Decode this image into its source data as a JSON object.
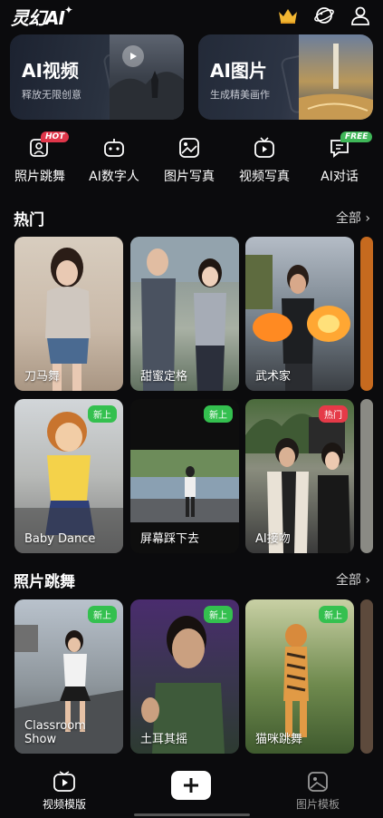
{
  "app": {
    "logo": "灵幻AI",
    "spark": "✦"
  },
  "heroes": [
    {
      "title": "AI视频",
      "subtitle": "释放无限创意"
    },
    {
      "title": "AI图片",
      "subtitle": "生成精美画作"
    }
  ],
  "quick_actions": [
    {
      "label": "照片跳舞",
      "badge": "HOT"
    },
    {
      "label": "AI数字人",
      "badge": ""
    },
    {
      "label": "图片写真",
      "badge": ""
    },
    {
      "label": "视频写真",
      "badge": ""
    },
    {
      "label": "AI对话",
      "badge": "FREE"
    }
  ],
  "sections": {
    "hot": {
      "title": "热门",
      "more": "全部",
      "row1": [
        {
          "label": "刀马舞",
          "tag": ""
        },
        {
          "label": "甜蜜定格",
          "tag": ""
        },
        {
          "label": "武术家",
          "tag": ""
        }
      ],
      "row2": [
        {
          "label": "Baby Dance",
          "tag": "新上"
        },
        {
          "label": "屏幕踩下去",
          "tag": "新上"
        },
        {
          "label": "AI接吻",
          "tag": "热门"
        }
      ]
    },
    "dance": {
      "title": "照片跳舞",
      "more": "全部",
      "row": [
        {
          "label_line1": "Classroom",
          "label_line2": "Show",
          "tag": "新上"
        },
        {
          "label": "土耳其摇",
          "tag": "新上"
        },
        {
          "label": "猫咪跳舞",
          "tag": "新上"
        }
      ]
    }
  },
  "bottom_nav": [
    {
      "label": "视频模版",
      "icon": "video-template-icon"
    },
    {
      "label": "",
      "icon": "plus-icon"
    },
    {
      "label": "图片模板",
      "icon": "image-template-icon"
    }
  ],
  "colors": {
    "background": "#0b0b0d",
    "hot_badge": "#e0364a",
    "new_tag": "#34c04f",
    "hot_tag": "#e53a48"
  }
}
